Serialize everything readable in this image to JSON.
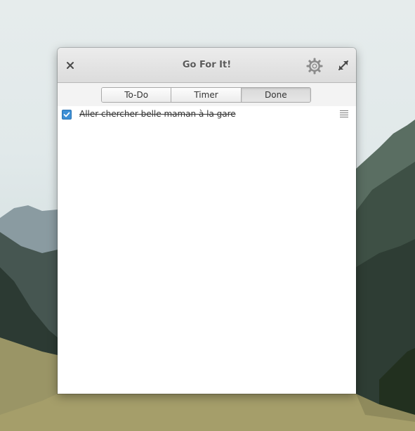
{
  "window": {
    "title": "Go For It!"
  },
  "titlebar": {
    "close_icon": "close-icon",
    "settings_icon": "gear-icon",
    "maximize_icon": "maximize-icon"
  },
  "tabs": [
    {
      "label": "To-Do",
      "active": false
    },
    {
      "label": "Timer",
      "active": false
    },
    {
      "label": "Done",
      "active": true
    }
  ],
  "tasks": [
    {
      "text": "Aller chercher belle maman à la gare",
      "done": true
    }
  ],
  "colors": {
    "checkbox": "#3d8fd5",
    "titlebar": "#dcdcdc"
  }
}
